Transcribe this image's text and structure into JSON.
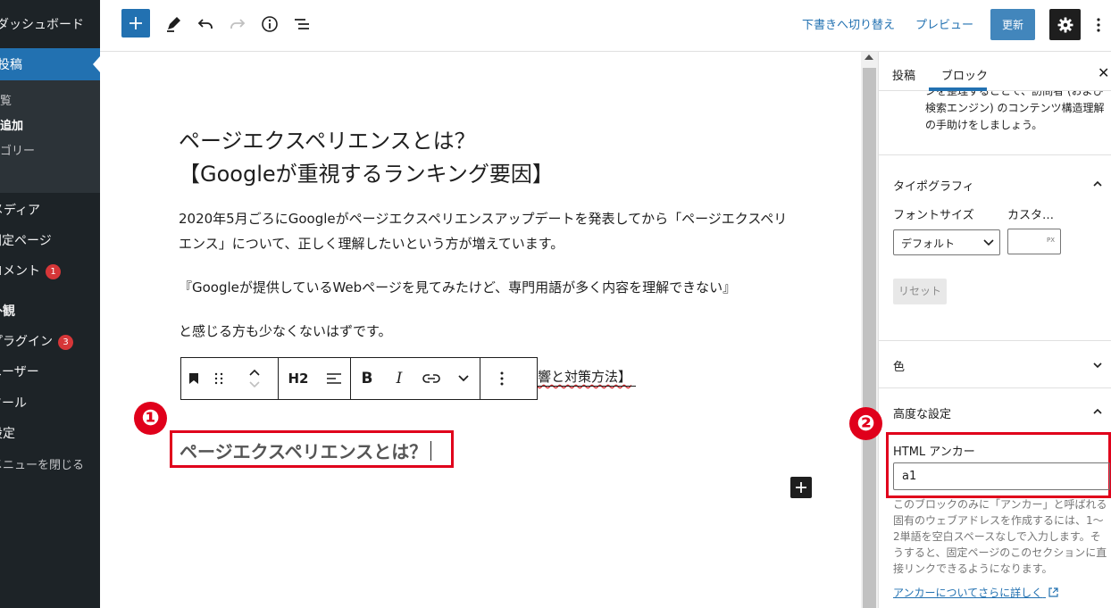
{
  "admin_menu": {
    "dashboard": "ダッシュボード",
    "posts": "投稿",
    "posts_sub": [
      "一覧",
      "新規追加",
      "カテゴリー"
    ],
    "media": "メディア",
    "pages": "固定ページ",
    "comments": "コメント",
    "comments_badge": "1",
    "appearance": "外観",
    "plugins": "プラグイン",
    "plugins_badge": "3",
    "users": "ユーザー",
    "tools": "ツール",
    "settings": "設定",
    "collapse": "メニューを閉じる"
  },
  "topbar": {
    "switch_to_draft": "下書きへ切り替え",
    "preview": "プレビュー",
    "update": "更新"
  },
  "editor": {
    "title_line1": "ページエクスペリエンスとは？",
    "title_line2": "【Googleが重視するランキング要因】",
    "p1": "2020年5月ごろにGoogleがページエクスペリエンスアップデートを発表してから「ページエクスペリエンス」について、正しく理解したいという方が増えています。",
    "p2": "『Googleが提供しているWebページを見てみたけど、専門用語が多く内容を理解できない』",
    "p3": "と感じる方も少なくないはずです。",
    "p4_tail": "響と対策方法】",
    "block_toolbar": {
      "heading_level": "H2",
      "bold": "B",
      "italic": "I"
    },
    "heading": "ページエクスペリエンスとは？",
    "marker1": "❶"
  },
  "sidebar": {
    "tab_post": "投稿",
    "tab_block": "ブロック",
    "prev_desc": "ンを整理することで、訪問者 (および検索エンジン) のコンテンツ構造理解の手助けをしましょう。",
    "typography": {
      "title": "タイポグラフィ",
      "font_size_label": "フォントサイズ",
      "custom_label": "カスタ…",
      "font_size_value": "デフォルト",
      "unit": "PX",
      "reset": "リセット"
    },
    "color_title": "色",
    "advanced": {
      "title": "高度な設定",
      "anchor_label": "HTML アンカー",
      "anchor_value": "a1",
      "help": "このブロックのみに「アンカー」と呼ばれる固有のウェブアドレスを作成するには、1〜2単語を空白スペースなしで入力します。そうすると、固定ページのこのセクションに直接リンクできるようになります。",
      "link": "アンカーについてさらに詳しく"
    },
    "marker2": "❷"
  },
  "colors": {
    "accent": "#2271b1",
    "admin_bg": "#1d2327",
    "highlight": "#e0001b"
  }
}
